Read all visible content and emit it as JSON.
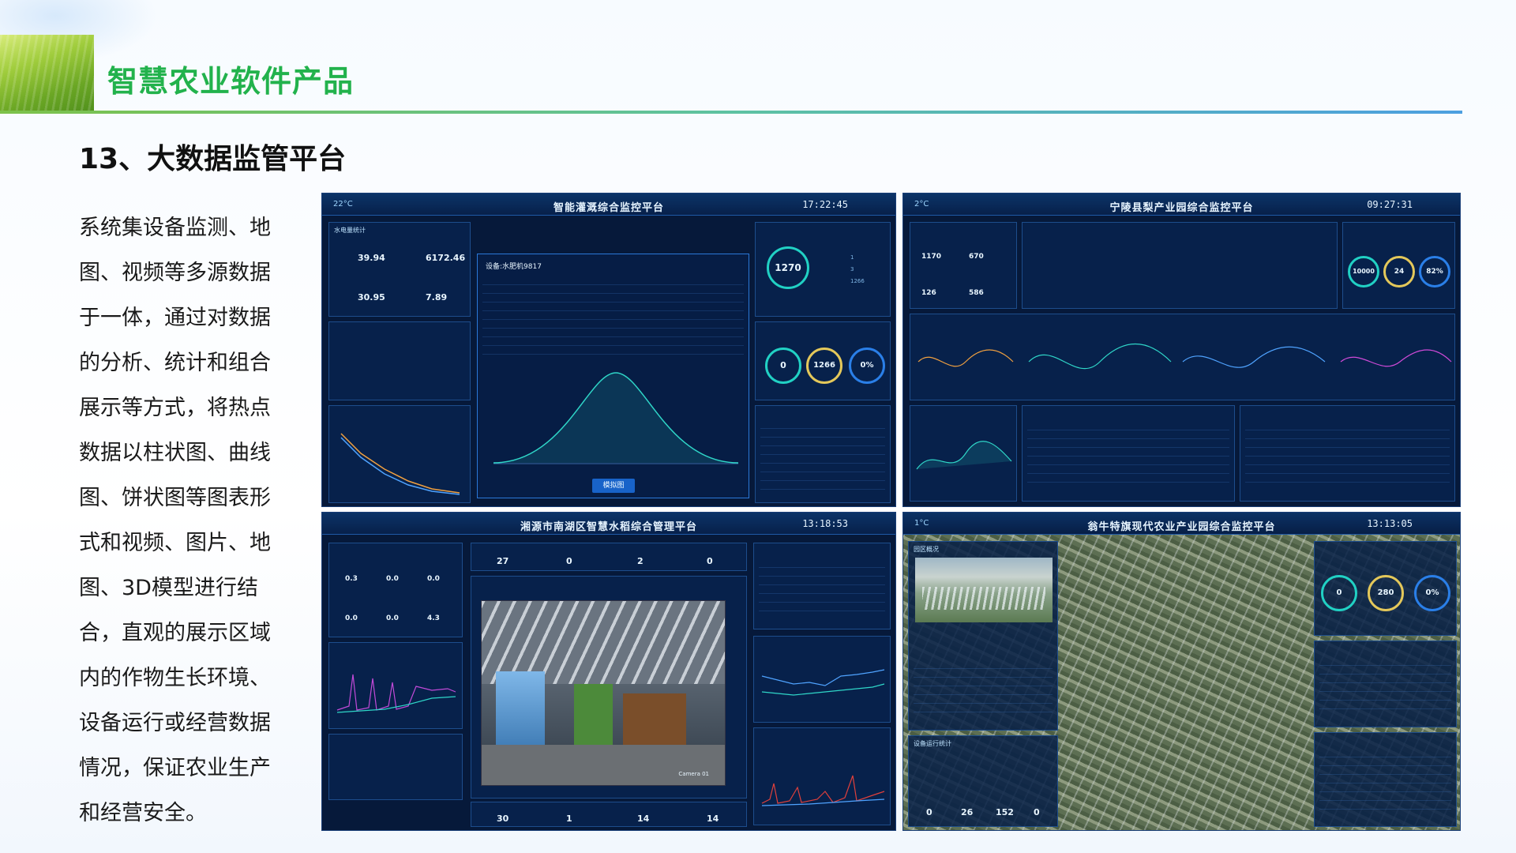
{
  "slide": {
    "heading": "智慧农业软件产品",
    "subtitle": "13、大数据监管平台",
    "body_lines": [
      "系统集设备监测、地",
      "图、视频等多源数据",
      "于一体，通过对数据",
      "的分析、统计和组合",
      "展示等方式，将热点",
      "数据以柱状图、曲线",
      "图、饼状图等图表形",
      "式和视频、图片、地",
      "图、3D模型进行结",
      "合，直观的展示区域",
      "内的作物生长环境、",
      "设备运行或经营数据",
      "情况，保证农业生产",
      "和经营安全。"
    ]
  },
  "panel1": {
    "title": "智能灌溉综合监控平台",
    "time": "17:22:45",
    "temp": "22°C",
    "left_box_label": "水电量统计",
    "stats": [
      "39.94",
      "6172.46",
      "30.95",
      "7.89"
    ],
    "modal_title": "设备:水肥机9817",
    "modal_button": "模拟图",
    "gauge_main": "1270",
    "gauge_a": "0",
    "gauge_b": "1266",
    "gauge_c": "0%",
    "legend_vals": [
      "1",
      "3",
      "1266"
    ]
  },
  "panel2": {
    "title": "宁陵县梨产业园综合监控平台",
    "time": "09:27:31",
    "temp": "2°C",
    "stats_top": [
      "1170",
      "670",
      "126",
      "586"
    ],
    "gauges": [
      "10000",
      "24",
      "82%"
    ]
  },
  "panel3": {
    "title": "湘源市南湖区智慧水稻综合管理平台",
    "time": "13:18:53",
    "top_counts": [
      "27",
      "0",
      "2",
      "0"
    ],
    "bottom_counts": [
      "30",
      "1",
      "14",
      "14"
    ],
    "sensors": [
      "0.3",
      "0.0",
      "0.0",
      "0.0",
      "0.0",
      "4.3"
    ],
    "camera_label": "Camera 01"
  },
  "panel4": {
    "title": "翁牛特旗现代农业产业园综合监控平台",
    "time": "13:13:05",
    "temp": "1°C",
    "left_box_label": "园区概况",
    "device_label": "设备运行统计",
    "gauges": [
      "0",
      "280",
      "0%"
    ],
    "bottom_counts": [
      "0",
      "26",
      "152",
      "0"
    ]
  }
}
